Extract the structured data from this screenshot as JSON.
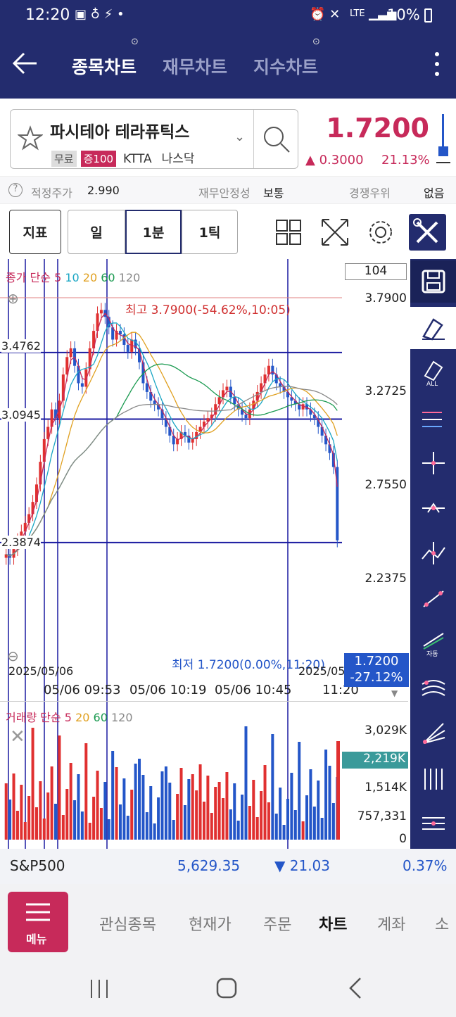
{
  "status": {
    "time": "12:20",
    "battery": "10%",
    "network": "LTE"
  },
  "header": {
    "tabs": [
      "종목차트",
      "재무차트",
      "지수차트"
    ],
    "active": 0
  },
  "stock": {
    "name": "파시테아 테라퓨틱스",
    "tags": [
      "무료",
      "증100",
      "KTTA",
      "나스닥"
    ],
    "price": "1.7200",
    "change": "▲ 0.3000",
    "change_pct": "21.13%"
  },
  "info": {
    "fair_label": "적정주가",
    "fair_value": "2.990",
    "stability_label": "재무안정성",
    "stability_value": "보통",
    "rank_label": "경쟁우위",
    "rank_value": "없음"
  },
  "toolbar": {
    "indicator": "지표",
    "periods": [
      "일",
      "1분",
      "1틱"
    ]
  },
  "chart": {
    "legend": {
      "title": "종가 단순",
      "ma": [
        "5",
        "10",
        "20",
        "60",
        "120"
      ]
    },
    "count_box": "104",
    "price_labels": [
      "3.7900",
      "3.2725",
      "2.7550",
      "2.2375"
    ],
    "hlines": [
      "3.4762",
      "3.0945",
      "2.3874"
    ],
    "high_annot": "최고 3.7900(-54.62%,10:05)",
    "low_annot": "최저 1.7200(0.00%,11:20)",
    "current_price": "1.7200",
    "current_pct": "-27.12%",
    "xaxis_top": "2025/05/06",
    "xaxis_top_right": "2025/05/",
    "x_ticks": [
      "05/06 09:53",
      "05/06 10:19",
      "05/06 10:45",
      "11:20"
    ],
    "volume_legend": {
      "title": "거래량 단순",
      "ma": [
        "5",
        "20",
        "60",
        "120"
      ]
    },
    "volume_labels": [
      "3,029K",
      "1,514K",
      "757,331",
      "0"
    ],
    "volume_current": "2,219K"
  },
  "chart_data": {
    "type": "candlestick",
    "x_ticks": [
      "05/06 09:53",
      "05/06 10:19",
      "05/06 10:45",
      "11:20"
    ],
    "ylim": [
      1.72,
      3.79
    ],
    "high": 3.79,
    "low": 1.72,
    "last": 1.72
  },
  "index": {
    "name": "S&P500",
    "value": "5,629.35",
    "change": "▼ 21.03",
    "pct": "0.37%"
  },
  "nav": {
    "menu": "메뉴",
    "items": [
      "관심종목",
      "현재가",
      "주문",
      "차트",
      "계좌",
      "소"
    ],
    "active": 3
  },
  "colors": {
    "brand": "#232c6e",
    "up": "#e03030",
    "down": "#2456c8",
    "accent": "#c72a5a"
  }
}
